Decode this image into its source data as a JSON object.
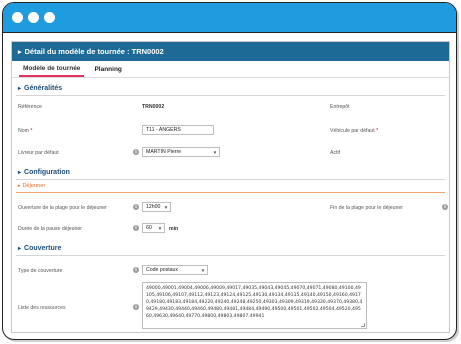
{
  "window": {
    "title": "Détail du modèle de tournée : TRN0002"
  },
  "tabs": [
    {
      "label": "Modèle de tournée"
    },
    {
      "label": "Planning"
    }
  ],
  "generalites": {
    "title": "Généralités",
    "reference_label": "Référence",
    "reference_value": "TRN0002",
    "entrepot_label": "Entrepôt",
    "nom_label": "Nom",
    "nom_value": "T11 - ANGERS",
    "vehicule_label": "Véhicule par défaut",
    "livreur_label": "Livreur par défaut",
    "livreur_value": "MARTIN Pierre",
    "actif_label": "Actif"
  },
  "configuration": {
    "title": "Configuration",
    "dejeuner_title": "Déjeuner",
    "ouverture_label": "Ouverture de la plage pour le déjeuner",
    "ouverture_value": "12h00",
    "fin_label": "Fin de la plage pour le déjeuner",
    "duree_label": "Durée de la pause déjeuner",
    "duree_value": "60",
    "duree_unit": "min"
  },
  "couverture": {
    "title": "Couverture",
    "type_label": "Type de couverture",
    "type_value": "Code postaux",
    "ressources_label": "Liste des ressources",
    "ressources_value": "49000,49001,49004,49006,49009,49017,49035,49043,49045,49070,49071,49080,49100,49105,49106,49107,49112,49123,49124,49125,49130,49134,49135,49140,49150,49160,49170,49180,49183,49184,49220,49240,49248,49250,49303,49309,49319,49330,49370,49380,49429,49430,49440,49460,49480,49481,49484,49490,49500,49501,49502,49504,49520,49560,49630,49640,49770,49800,49803,49807,49941"
  }
}
